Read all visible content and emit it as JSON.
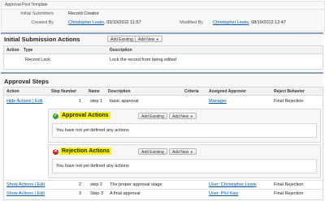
{
  "header": {
    "template_name": "Approval Post Template",
    "initial_submitters_label": "Initial Submitters",
    "initial_submitters_value": "Record Creator",
    "created_by_label": "Created By",
    "created_by_user": "Christopher Lewis",
    "created_by_date": ", 03/10/2012 11:57",
    "modified_by_label": "Modified By",
    "modified_by_user": "Christopher Lewis",
    "modified_by_date": ", 08/10/2012 12:47"
  },
  "initial_actions": {
    "title": "Initial Submission Actions",
    "add_existing": "Add Existing",
    "add_new": "Add New",
    "columns": [
      "Action",
      "Type",
      "Description"
    ],
    "rows": [
      {
        "type": "Record Lock",
        "description": "Lock the record from being edited"
      }
    ]
  },
  "approval_steps": {
    "title": "Approval Steps",
    "columns": [
      "Action",
      "Step Number",
      "Name",
      "Description",
      "Criteria",
      "Assigned Approver",
      "Reject Behavior"
    ],
    "step1": {
      "actions": "Hide Actions | Edit",
      "number": "1",
      "name": "step 1",
      "description": "basic approval",
      "approver": "Manager",
      "reject": "Final Rejection"
    },
    "approval_actions": {
      "title": "Approval Actions",
      "add_existing": "Add Existing",
      "add_new": "Add New",
      "empty": "You have not yet defined any actions"
    },
    "rejection_actions": {
      "title": "Rejection Actions",
      "add_existing": "Add Existing",
      "add_new": "Add New",
      "empty": "You have not yet defined any actions"
    },
    "step2": {
      "actions": "Show Actions | Edit",
      "number": "2",
      "name": "step 2",
      "description": "The proper approval stage",
      "approver": "User: Christopher Lewis",
      "reject": "Final Rejection"
    },
    "step3": {
      "actions": "Show Actions | Edit",
      "number": "3",
      "name": "Step 3",
      "description": "A final approval",
      "approver": "User: Phil Katz",
      "reject": "Final Rejection"
    }
  },
  "icons": {
    "approve": "check-circle-icon",
    "reject": "x-circle-icon",
    "dropdown": "triangle-down-icon"
  },
  "colors": {
    "highlight": "#f7f314",
    "approve_icon": "#3a9a2f",
    "reject_icon": "#c8201f",
    "link": "#015ba7"
  }
}
